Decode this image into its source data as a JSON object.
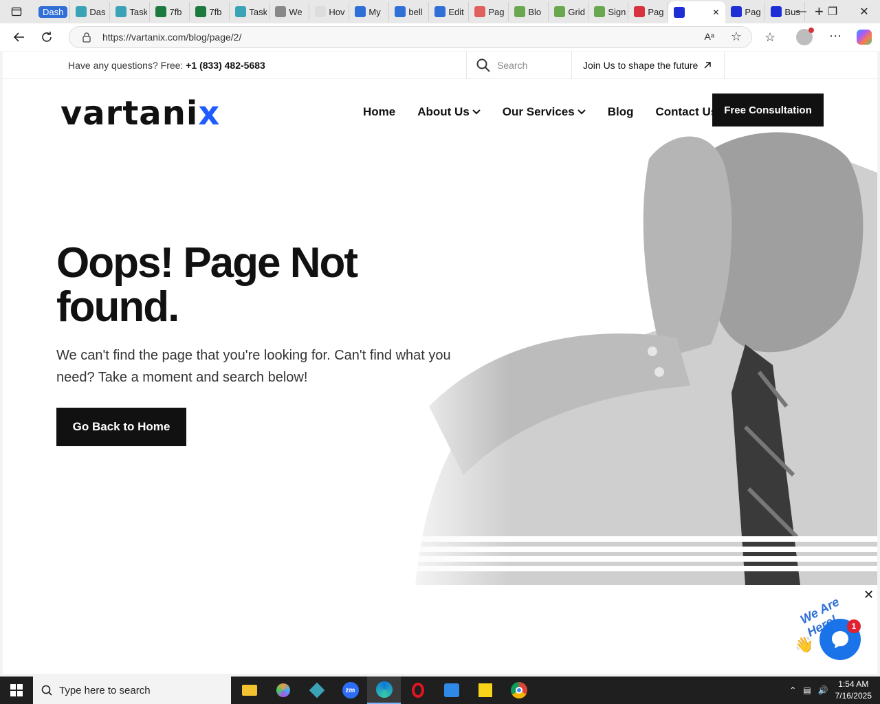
{
  "browser": {
    "tabs": [
      {
        "title": "Dash",
        "color": "#2f6fd6",
        "style": "pill"
      },
      {
        "title": "Das",
        "color": "#3aa3b5"
      },
      {
        "title": "Task",
        "color": "#3aa3b5"
      },
      {
        "title": "7fb",
        "color": "#1d7a3e"
      },
      {
        "title": "7fb",
        "color": "#1d7a3e"
      },
      {
        "title": "Task",
        "color": "#3aa3b5"
      },
      {
        "title": "We",
        "color": "#888888"
      },
      {
        "title": "Hov",
        "color": "#dddddd"
      },
      {
        "title": "My",
        "color": "#2f6fd6"
      },
      {
        "title": "bell",
        "color": "#2f6fd6"
      },
      {
        "title": "Edit",
        "color": "#2f6fd6"
      },
      {
        "title": "Pag",
        "color": "#e06060"
      },
      {
        "title": "Blo",
        "color": "#6aa84f"
      },
      {
        "title": "Grid",
        "color": "#6aa84f"
      },
      {
        "title": "Sign",
        "color": "#6aa84f"
      },
      {
        "title": "Pag",
        "color": "#d9323f"
      },
      {
        "title": "",
        "color": "#1e2fd6",
        "active": true
      },
      {
        "title": "Pag",
        "color": "#1e2fd6"
      },
      {
        "title": "Bus",
        "color": "#1e2fd6"
      }
    ],
    "url": "https://vartanix.com/blog/page/2/"
  },
  "site": {
    "topbar": {
      "question": "Have any questions? Free: ",
      "phone": "+1 (833) 482-5683",
      "search_placeholder": "Search",
      "join_text": "Join Us to shape the future"
    },
    "logo": {
      "main": "vartani",
      "accent": "x"
    },
    "nav": {
      "home": "Home",
      "about": "About Us",
      "services": "Our Services",
      "blog": "Blog",
      "contact": "Contact Us",
      "cta": "Free Consultation"
    },
    "hero": {
      "heading": "Oops! Page Not found.",
      "subtext": "We can't find the page that you're looking for. Can't find what you need? Take a moment and search below!",
      "button": "Go Back to Home"
    },
    "chat": {
      "tagline": "We Are Here!",
      "badge": "1"
    }
  },
  "taskbar": {
    "search_placeholder": "Type here to search",
    "time": "1:54 AM",
    "date": "7/16/2025",
    "apps": [
      "file-explorer",
      "paint",
      "app-diamond",
      "zoom",
      "edge",
      "opera",
      "photos",
      "sticky-notes",
      "chrome"
    ]
  },
  "colors": {
    "brand_accent": "#1e5cff",
    "cta_bg": "#111111",
    "chat_blue": "#1a73e8",
    "badge_red": "#e0212f"
  }
}
